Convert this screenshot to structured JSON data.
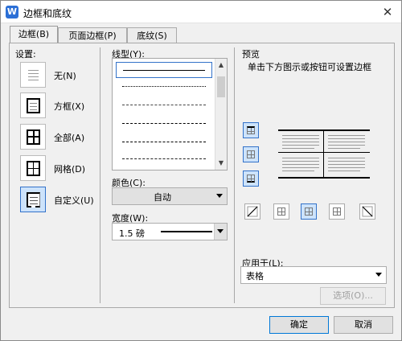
{
  "window": {
    "icon_letter": "W",
    "title": "边框和底纹",
    "close": "✕"
  },
  "tabs": [
    {
      "label": "边框(B)"
    },
    {
      "label": "页面边框(P)"
    },
    {
      "label": "底纹(S)"
    }
  ],
  "settings": {
    "heading": "设置:",
    "items": [
      {
        "label": "无(N)"
      },
      {
        "label": "方框(X)"
      },
      {
        "label": "全部(A)"
      },
      {
        "label": "网格(D)"
      },
      {
        "label": "自定义(U)"
      }
    ],
    "selected": "自定义(U)"
  },
  "line_style": {
    "label": "线型(Y):"
  },
  "color": {
    "label": "颜色(C):",
    "value": "自动"
  },
  "width": {
    "label": "宽度(W):",
    "value": "1.5 磅"
  },
  "preview": {
    "heading": "预览",
    "hint": "单击下方图示或按钮可设置边框"
  },
  "apply_to": {
    "label": "应用于(L):",
    "value": "表格"
  },
  "options_button": "选项(O)...",
  "ok_button": "确定",
  "cancel_button": "取消",
  "colors": {
    "accent": "#3372c9",
    "selected_bg": "#cde3fb",
    "app_blue": "#2b6fd6"
  }
}
